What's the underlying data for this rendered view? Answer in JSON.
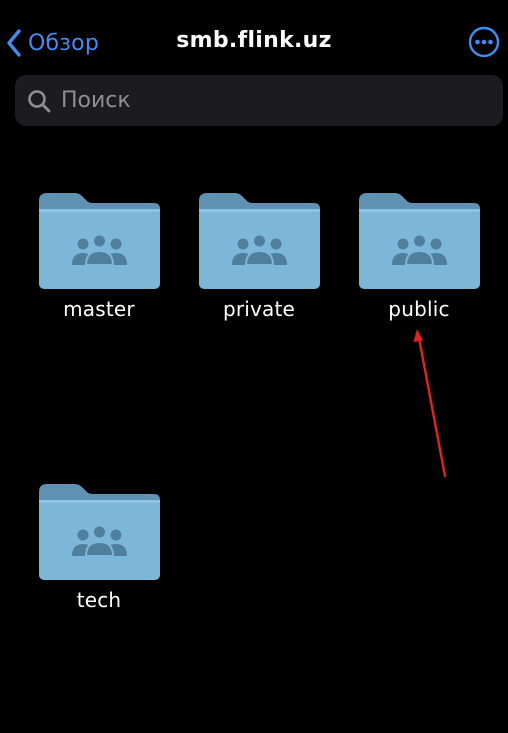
{
  "nav": {
    "back_label": "Обзор",
    "title": "smb.flink.uz"
  },
  "search": {
    "placeholder": "Поиск"
  },
  "folders": [
    {
      "name": "master"
    },
    {
      "name": "private"
    },
    {
      "name": "public"
    },
    {
      "name": "tech"
    }
  ],
  "icons": {
    "back": "chevron-left-icon",
    "more": "ellipsis-circle-icon",
    "search": "magnifier-icon",
    "folder": "shared-folder-icon"
  },
  "colors": {
    "background": "#000000",
    "accent": "#3a8ef6",
    "search_field": "#1c1c1e",
    "placeholder": "#8e8e93",
    "folder_back": "#5f91b2",
    "folder_front": "#7cb7d9",
    "folder_glyph": "#4f7f9d",
    "annotation": "#e8201e"
  }
}
